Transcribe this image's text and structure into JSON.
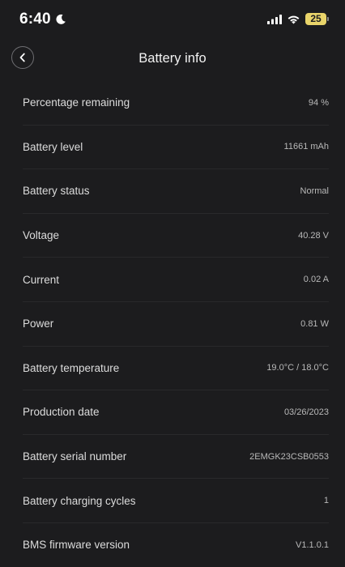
{
  "status_bar": {
    "time": "6:40",
    "battery_level": "25"
  },
  "header": {
    "title": "Battery info"
  },
  "rows": [
    {
      "label": "Percentage remaining",
      "value": "94 %"
    },
    {
      "label": "Battery level",
      "value": "11661 mAh"
    },
    {
      "label": "Battery status",
      "value": "Normal"
    },
    {
      "label": "Voltage",
      "value": "40.28 V"
    },
    {
      "label": "Current",
      "value": "0.02 A"
    },
    {
      "label": "Power",
      "value": "0.81 W"
    },
    {
      "label": "Battery temperature",
      "value": "19.0°C / 18.0°C"
    },
    {
      "label": "Production date",
      "value": "03/26/2023"
    },
    {
      "label": "Battery serial number",
      "value": "2EMGK23CSB0553"
    },
    {
      "label": "Battery charging cycles",
      "value": "1"
    },
    {
      "label": "BMS firmware version",
      "value": "V1.1.0.1"
    }
  ],
  "colors": {
    "background": "#1c1c1e",
    "battery_badge": "#e9d46a",
    "divider": "#29292b"
  },
  "icons": {
    "moon": "moon-icon",
    "signal": "cellular-signal-icon",
    "wifi": "wifi-icon",
    "battery": "battery-icon",
    "back": "chevron-left-icon"
  }
}
